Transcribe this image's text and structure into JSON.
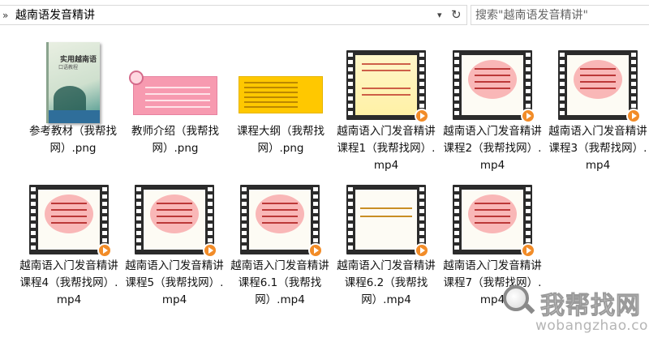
{
  "address_bar": {
    "path": "越南语发音精讲"
  },
  "search": {
    "placeholder": "搜索\"越南语发音精讲\""
  },
  "files": [
    {
      "name": "参考教材（我帮找网）.png",
      "kind": "book-cover",
      "book_title": "实用越南语",
      "book_subtitle": "口语教程"
    },
    {
      "name": "教师介绍（我帮找网）.png",
      "kind": "pink-doc"
    },
    {
      "name": "课程大纲（我帮找网）.png",
      "kind": "yellow-doc"
    },
    {
      "name": "越南语入门发音精讲课程1（我帮找网）.mp4",
      "kind": "video-cartoon"
    },
    {
      "name": "越南语入门发音精讲课程2（我帮找网）.mp4",
      "kind": "video-bubble"
    },
    {
      "name": "越南语入门发音精讲课程3（我帮找网）.mp4",
      "kind": "video-bubble"
    },
    {
      "name": "越南语入门发音精讲课程4（我帮找网）.mp4",
      "kind": "video-bubble"
    },
    {
      "name": "越南语入门发音精讲课程5（我帮找网）.mp4",
      "kind": "video-bubble"
    },
    {
      "name": "越南语入门发音精讲课程6.1（我帮找网）.mp4",
      "kind": "video-bubble"
    },
    {
      "name": "越南语入门发音精讲课程6.2（我帮找网）.mp4",
      "kind": "video-plain"
    },
    {
      "name": "越南语入门发音精讲课程7（我帮找网）.mp4",
      "kind": "video-bubble"
    }
  ],
  "watermark": {
    "cn": "我帮找网",
    "en": "wobangzhao.com"
  },
  "colors": {
    "play_badge": "#f28c28",
    "pink_doc": "#f79ab0",
    "yellow_doc": "#ffc800"
  }
}
